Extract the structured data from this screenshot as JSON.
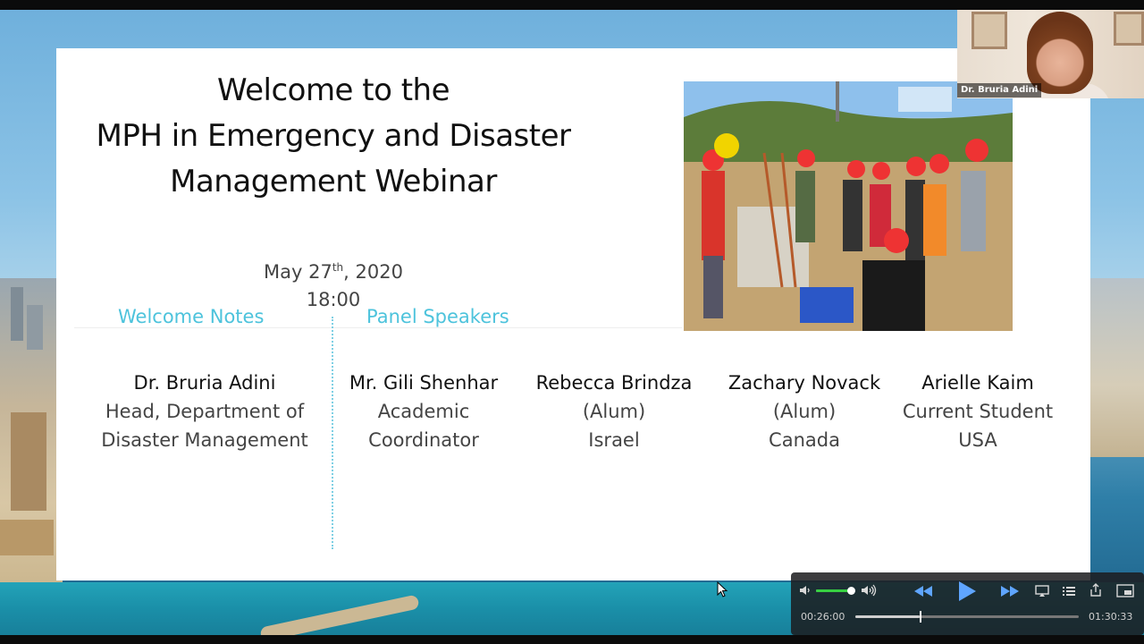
{
  "slide": {
    "title_lines": [
      "Welcome to the",
      "MPH in Emergency and Disaster",
      "Management Webinar"
    ],
    "date_prefix": "May 27",
    "date_sup": "th",
    "date_suffix": ", 2020",
    "time": "18:00",
    "welcome_heading": "Welcome Notes",
    "panel_heading": "Panel Speakers",
    "speakers": [
      {
        "name": "Dr. Bruria Adini",
        "line2": "Head,  Department of",
        "line3": "Disaster Management"
      },
      {
        "name": "Mr. Gili Shenhar",
        "line2": "Academic",
        "line3": "Coordinator"
      },
      {
        "name": "Rebecca Brindza",
        "line2": "(Alum)",
        "line3": "Israel"
      },
      {
        "name": "Zachary Novack",
        "line2": "(Alum)",
        "line3": "Canada"
      },
      {
        "name": "Arielle Kaim",
        "line2": "Current Student",
        "line3": "USA"
      }
    ]
  },
  "webcam": {
    "participant_name": "Dr. Bruria Adini"
  },
  "player": {
    "current_time": "00:26:00",
    "total_time": "01:30:33",
    "progress": 0.287,
    "volume": 0.95,
    "icons": [
      "volume-low-icon",
      "volume-high-icon",
      "rewind-icon",
      "play-icon",
      "fast-forward-icon",
      "airplay-icon",
      "chapters-icon",
      "share-icon",
      "picture-in-picture-icon"
    ]
  },
  "colors": {
    "accent": "#4dc3dc",
    "volume_fill": "#37d042"
  }
}
